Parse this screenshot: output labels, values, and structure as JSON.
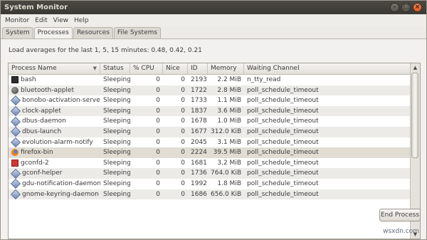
{
  "window": {
    "title": "System Monitor"
  },
  "menu": [
    "Monitor",
    "Edit",
    "View",
    "Help"
  ],
  "tabs": [
    "System",
    "Processes",
    "Resources",
    "File Systems"
  ],
  "active_tab": "Processes",
  "load_averages": "Load averages for the last 1, 5, 15 minutes: 0.48, 0.42, 0.21",
  "table": {
    "columns": [
      "Process Name",
      "Status",
      "% CPU",
      "Nice",
      "ID",
      "Memory",
      "Waiting Channel"
    ],
    "rows": [
      {
        "icon": "terminal-icon",
        "name": "bash",
        "status": "Sleeping",
        "cpu": "0",
        "nice": "0",
        "id": "2193",
        "memory": "2.2 MiB",
        "waiting": "n_tty_read"
      },
      {
        "icon": "bluetooth-icon",
        "name": "bluetooth-applet",
        "status": "Sleeping",
        "cpu": "0",
        "nice": "0",
        "id": "1722",
        "memory": "2.8 MiB",
        "waiting": "poll_schedule_timeout"
      },
      {
        "icon": "process-diamond-icon",
        "name": "bonobo-activation-server",
        "status": "Sleeping",
        "cpu": "0",
        "nice": "0",
        "id": "1733",
        "memory": "1.1 MiB",
        "waiting": "poll_schedule_timeout"
      },
      {
        "icon": "process-diamond-icon",
        "name": "clock-applet",
        "status": "Sleeping",
        "cpu": "0",
        "nice": "0",
        "id": "1837",
        "memory": "3.6 MiB",
        "waiting": "poll_schedule_timeout"
      },
      {
        "icon": "process-diamond-icon",
        "name": "dbus-daemon",
        "status": "Sleeping",
        "cpu": "0",
        "nice": "0",
        "id": "1678",
        "memory": "1.0 MiB",
        "waiting": "poll_schedule_timeout"
      },
      {
        "icon": "process-diamond-icon",
        "name": "dbus-launch",
        "status": "Sleeping",
        "cpu": "0",
        "nice": "0",
        "id": "1677",
        "memory": "312.0 KiB",
        "waiting": "poll_schedule_timeout"
      },
      {
        "icon": "process-diamond-icon",
        "name": "evolution-alarm-notify",
        "status": "Sleeping",
        "cpu": "0",
        "nice": "0",
        "id": "2045",
        "memory": "3.1 MiB",
        "waiting": "poll_schedule_timeout"
      },
      {
        "icon": "firefox-icon",
        "name": "firefox-bin",
        "status": "Sleeping",
        "cpu": "0",
        "nice": "0",
        "id": "2224",
        "memory": "39.5 MiB",
        "waiting": "poll_schedule_timeout",
        "selected": true
      },
      {
        "icon": "gconf-icon",
        "name": "gconfd-2",
        "status": "Sleeping",
        "cpu": "0",
        "nice": "0",
        "id": "1681",
        "memory": "3.2 MiB",
        "waiting": "poll_schedule_timeout"
      },
      {
        "icon": "process-diamond-icon",
        "name": "gconf-helper",
        "status": "Sleeping",
        "cpu": "0",
        "nice": "0",
        "id": "1736",
        "memory": "764.0 KiB",
        "waiting": "poll_schedule_timeout"
      },
      {
        "icon": "process-diamond-icon",
        "name": "gdu-notification-daemon",
        "status": "Sleeping",
        "cpu": "0",
        "nice": "0",
        "id": "1992",
        "memory": "1.8 MiB",
        "waiting": "poll_schedule_timeout"
      },
      {
        "icon": "process-diamond-icon",
        "name": "gnome-keyring-daemon",
        "status": "Sleeping",
        "cpu": "0",
        "nice": "0",
        "id": "1686",
        "memory": "656.0 KiB",
        "waiting": "poll_schedule_timeout"
      }
    ]
  },
  "buttons": {
    "end_process": "End Process"
  },
  "watermark": "wsxdn.com"
}
